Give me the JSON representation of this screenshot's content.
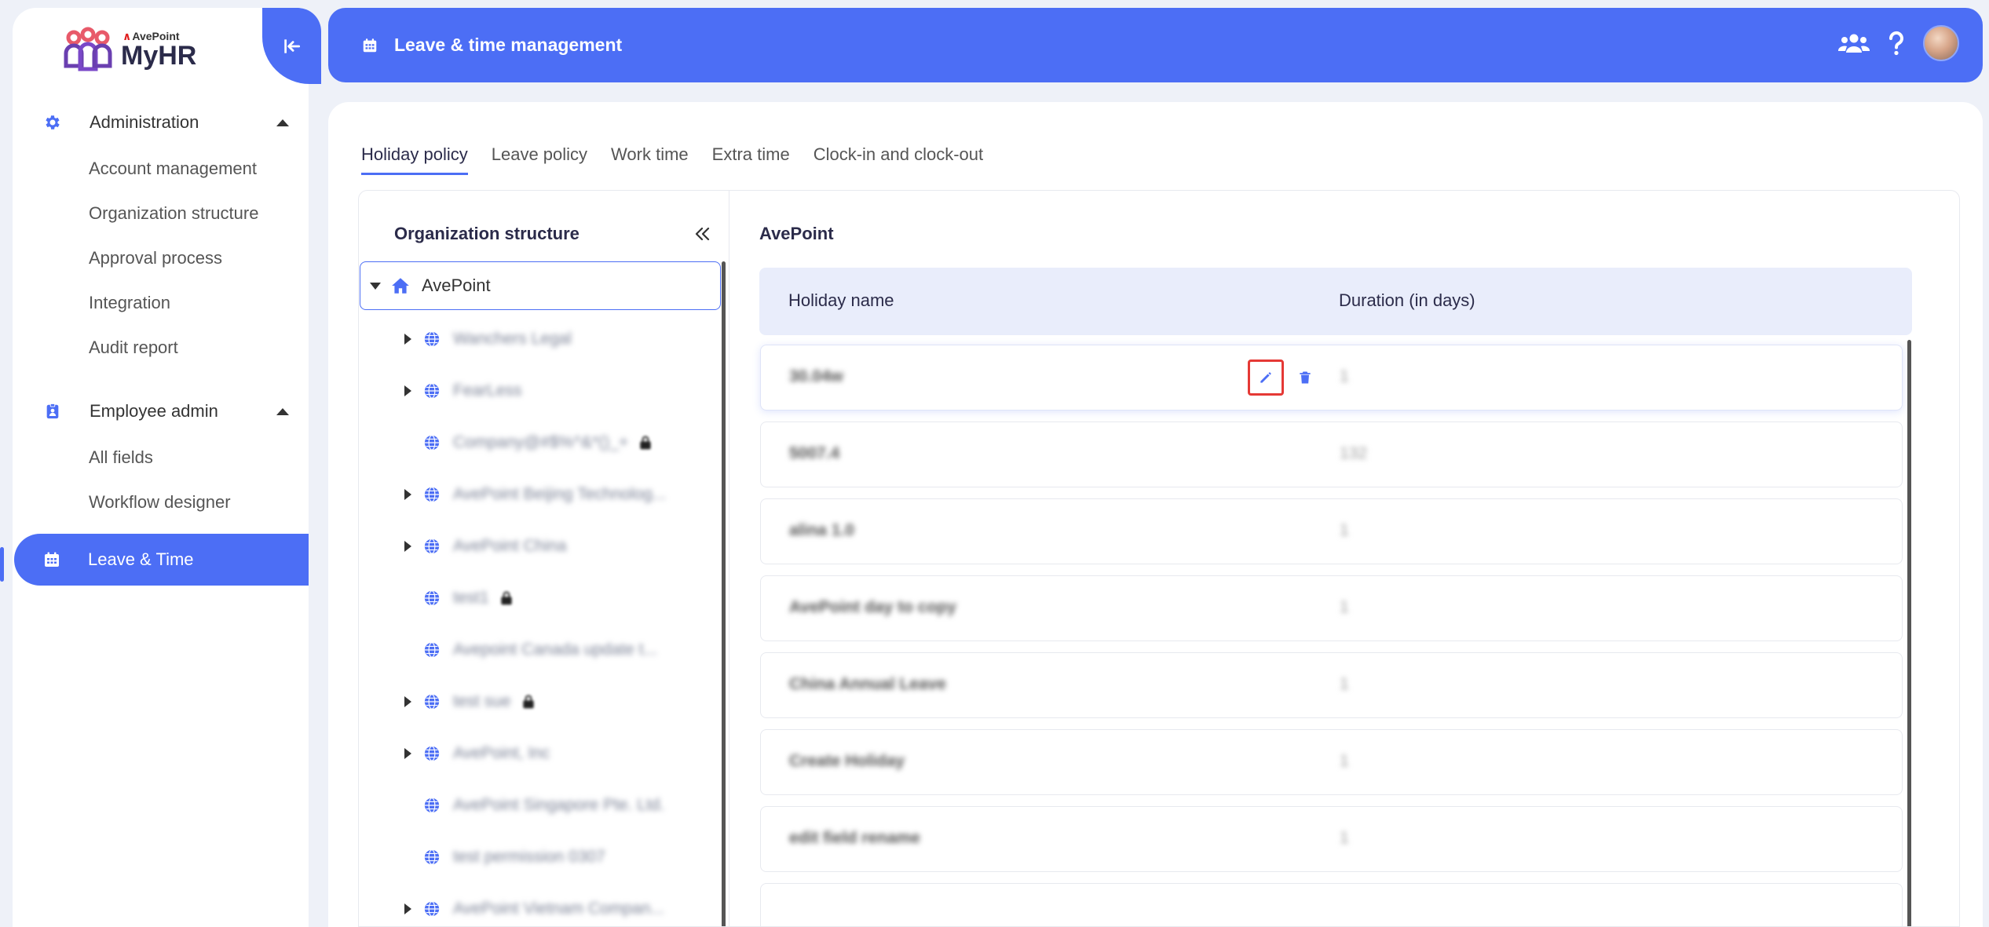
{
  "sidebar": {
    "logo": {
      "company": "AvePoint",
      "product": "MyHR"
    },
    "groups": [
      {
        "label": "Administration",
        "icon": "gear-icon",
        "items": [
          "Account management",
          "Organization structure",
          "Approval process",
          "Integration",
          "Audit report"
        ]
      },
      {
        "label": "Employee admin",
        "icon": "id-badge-icon",
        "items": [
          "All fields",
          "Workflow designer"
        ]
      }
    ],
    "active": {
      "label": "Leave & Time",
      "icon": "calendar-icon"
    }
  },
  "header": {
    "title": "Leave & time management",
    "icons": [
      "users-icon",
      "help-icon",
      "avatar"
    ]
  },
  "tabs": [
    {
      "label": "Holiday policy",
      "active": true
    },
    {
      "label": "Leave policy",
      "active": false
    },
    {
      "label": "Work time",
      "active": false
    },
    {
      "label": "Extra time",
      "active": false
    },
    {
      "label": "Clock-in and clock-out",
      "active": false
    }
  ],
  "tree": {
    "title": "Organization structure",
    "root": "AvePoint",
    "nodes": [
      {
        "label": "Wanchers Legal",
        "expandable": true,
        "locked": false
      },
      {
        "label": "FearLess",
        "expandable": true,
        "locked": false
      },
      {
        "label": "Company@#$%^&*()_+",
        "expandable": false,
        "locked": true
      },
      {
        "label": "AvePoint Beijing Technolog...",
        "expandable": true,
        "locked": false
      },
      {
        "label": "AvePoint China",
        "expandable": true,
        "locked": false
      },
      {
        "label": "test1",
        "expandable": false,
        "locked": true
      },
      {
        "label": "Avepoint Canada update t...",
        "expandable": false,
        "locked": false
      },
      {
        "label": "test sue",
        "expandable": true,
        "locked": true
      },
      {
        "label": "AvePoint, Inc",
        "expandable": true,
        "locked": false
      },
      {
        "label": "AvePoint Singapore Pte. Ltd.",
        "expandable": false,
        "locked": false
      },
      {
        "label": "test permission 0307",
        "expandable": false,
        "locked": false
      },
      {
        "label": "AvePoint Vietnam Compan...",
        "expandable": true,
        "locked": false
      }
    ]
  },
  "holidays": {
    "org": "AvePoint",
    "columns": [
      "Holiday name",
      "Duration (in days)"
    ],
    "rows": [
      {
        "name": "30.04w",
        "duration": "1"
      },
      {
        "name": "5007.4",
        "duration": "132"
      },
      {
        "name": "alina 1.0",
        "duration": "1"
      },
      {
        "name": "AvePoint day to copy",
        "duration": "1"
      },
      {
        "name": "China Annual Leave",
        "duration": "1"
      },
      {
        "name": "Create Holiday",
        "duration": "1"
      },
      {
        "name": "edit field rename",
        "duration": "1"
      },
      {
        "name": "",
        "duration": ""
      }
    ]
  },
  "colors": {
    "primary": "#4c6ef5",
    "highlight": "#e53935"
  }
}
